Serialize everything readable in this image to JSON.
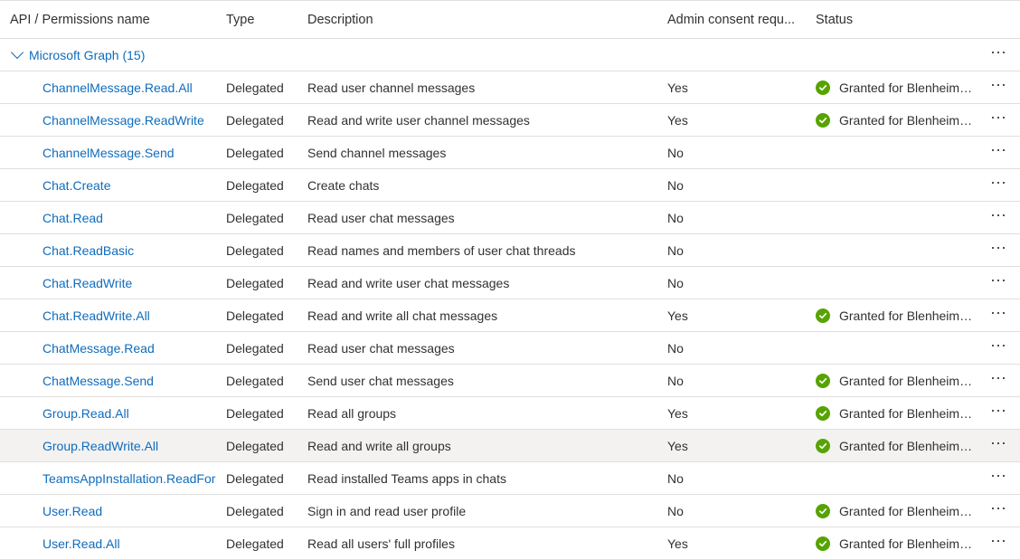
{
  "header": {
    "name": "API / Permissions name",
    "type": "Type",
    "description": "Description",
    "admin": "Admin consent requ...",
    "status": "Status"
  },
  "group": {
    "label": "Microsoft Graph (15)",
    "more": "···"
  },
  "rows": [
    {
      "name": "ChannelMessage.Read.All",
      "type": "Delegated",
      "description": "Read user channel messages",
      "admin": "Yes",
      "status": "Granted for Blenheim C...",
      "granted": true
    },
    {
      "name": "ChannelMessage.ReadWrite",
      "type": "Delegated",
      "description": "Read and write user channel messages",
      "admin": "Yes",
      "status": "Granted for Blenheim C...",
      "granted": true
    },
    {
      "name": "ChannelMessage.Send",
      "type": "Delegated",
      "description": "Send channel messages",
      "admin": "No",
      "status": "",
      "granted": false
    },
    {
      "name": "Chat.Create",
      "type": "Delegated",
      "description": "Create chats",
      "admin": "No",
      "status": "",
      "granted": false
    },
    {
      "name": "Chat.Read",
      "type": "Delegated",
      "description": "Read user chat messages",
      "admin": "No",
      "status": "",
      "granted": false
    },
    {
      "name": "Chat.ReadBasic",
      "type": "Delegated",
      "description": "Read names and members of user chat threads",
      "admin": "No",
      "status": "",
      "granted": false
    },
    {
      "name": "Chat.ReadWrite",
      "type": "Delegated",
      "description": "Read and write user chat messages",
      "admin": "No",
      "status": "",
      "granted": false
    },
    {
      "name": "Chat.ReadWrite.All",
      "type": "Delegated",
      "description": "Read and write all chat messages",
      "admin": "Yes",
      "status": "Granted for Blenheim C...",
      "granted": true
    },
    {
      "name": "ChatMessage.Read",
      "type": "Delegated",
      "description": "Read user chat messages",
      "admin": "No",
      "status": "",
      "granted": false
    },
    {
      "name": "ChatMessage.Send",
      "type": "Delegated",
      "description": "Send user chat messages",
      "admin": "No",
      "status": "Granted for Blenheim C...",
      "granted": true
    },
    {
      "name": "Group.Read.All",
      "type": "Delegated",
      "description": "Read all groups",
      "admin": "Yes",
      "status": "Granted for Blenheim C...",
      "granted": true
    },
    {
      "name": "Group.ReadWrite.All",
      "type": "Delegated",
      "description": "Read and write all groups",
      "admin": "Yes",
      "status": "Granted for Blenheim C...",
      "granted": true,
      "selected": true
    },
    {
      "name": "TeamsAppInstallation.ReadForCh",
      "type": "Delegated",
      "description": "Read installed Teams apps in chats",
      "admin": "No",
      "status": "",
      "granted": false
    },
    {
      "name": "User.Read",
      "type": "Delegated",
      "description": "Sign in and read user profile",
      "admin": "No",
      "status": "Granted for Blenheim C...",
      "granted": true
    },
    {
      "name": "User.Read.All",
      "type": "Delegated",
      "description": "Read all users' full profiles",
      "admin": "Yes",
      "status": "Granted for Blenheim C...",
      "granted": true
    }
  ],
  "more_label": "···",
  "colors": {
    "link": "#0f6cbd",
    "granted": "#57a300",
    "selected_row": "#f3f2f1",
    "divider": "#e1dfdd"
  },
  "icons": {
    "granted": "check-circle-icon",
    "more": "more-horizontal-icon",
    "expand": "chevron-down-icon"
  }
}
